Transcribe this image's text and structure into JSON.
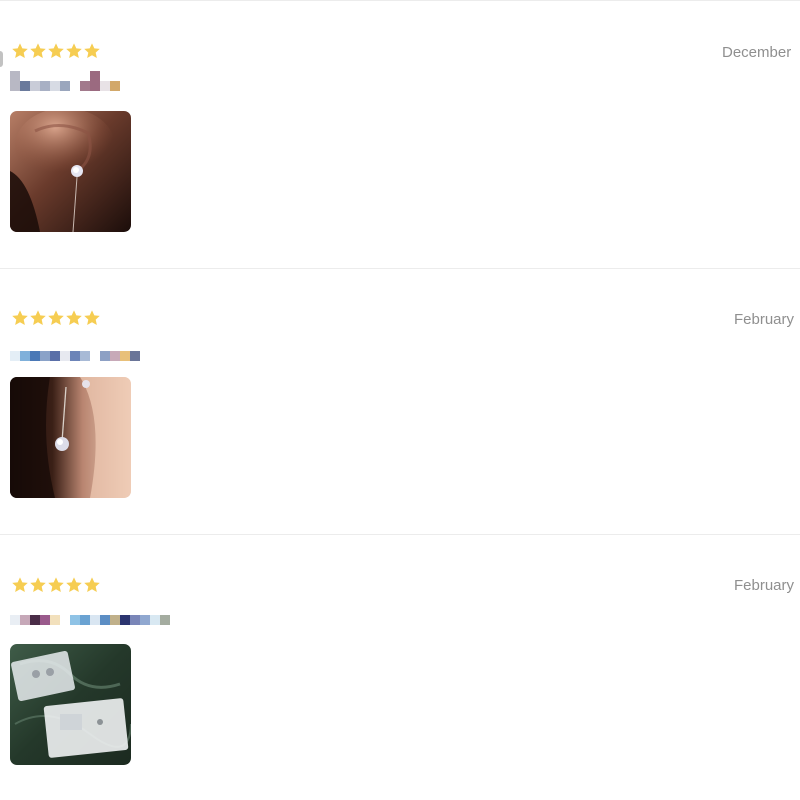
{
  "reviews": [
    {
      "rating": 5,
      "date": "December",
      "author": "",
      "photo": "ear-stud-photo",
      "accent": "#f5c842"
    },
    {
      "rating": 5,
      "date": "February",
      "author": "",
      "photo": "ear-dangle-photo",
      "accent": "#f5c842"
    },
    {
      "rating": 5,
      "date": "February",
      "author": "",
      "photo": "packaged-earrings-photo",
      "accent": "#f5c842"
    }
  ]
}
